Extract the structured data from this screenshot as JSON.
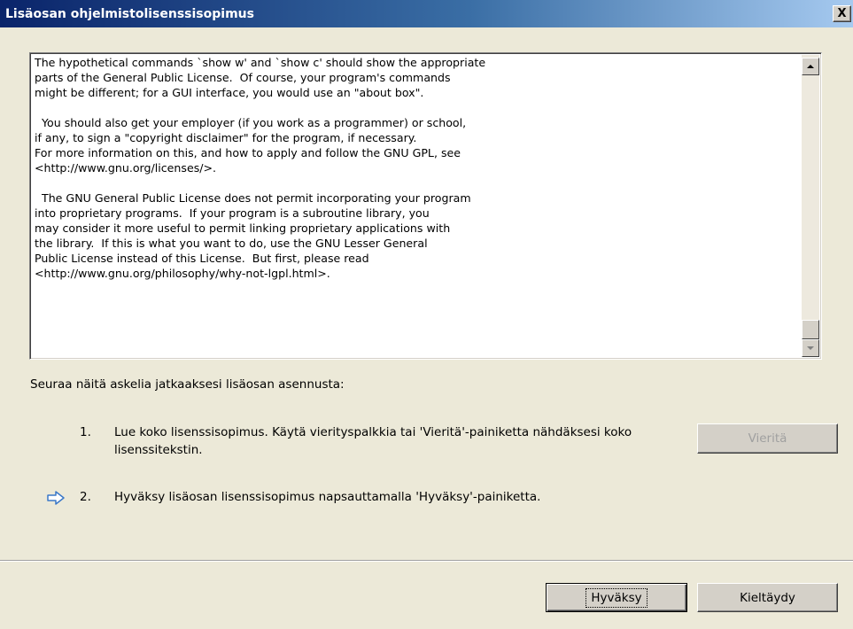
{
  "window": {
    "title": "Lisäosan ohjelmistolisenssisopimus",
    "close_glyph": "X"
  },
  "license": {
    "text": "The hypothetical commands `show w' and `show c' should show the appropriate\nparts of the General Public License.  Of course, your program's commands\nmight be different; for a GUI interface, you would use an \"about box\".\n\n  You should also get your employer (if you work as a programmer) or school,\nif any, to sign a \"copyright disclaimer\" for the program, if necessary.\nFor more information on this, and how to apply and follow the GNU GPL, see\n<http://www.gnu.org/licenses/>.\n\n  The GNU General Public License does not permit incorporating your program\ninto proprietary programs.  If your program is a subroutine library, you\nmay consider it more useful to permit linking proprietary applications with\nthe library.  If this is what you want to do, use the GNU Lesser General\nPublic License instead of this License.  But first, please read\n<http://www.gnu.org/philosophy/why-not-lgpl.html>."
  },
  "instructions": {
    "heading": "Seuraa näitä askelia jatkaaksesi lisäosan asennusta:",
    "steps": [
      {
        "number": "1.",
        "text": "Lue koko lisenssisopimus. Käytä vierityspalkkia tai 'Vieritä'-painiketta nähdäksesi koko lisenssitekstin."
      },
      {
        "number": "2.",
        "text": "Hyväksy lisäosan lisenssisopimus napsauttamalla 'Hyväksy'-painiketta."
      }
    ],
    "current_step_icon": "arrow-right-icon",
    "scroll_button_label": "Vieritä"
  },
  "buttons": {
    "accept": "Hyväksy",
    "decline": "Kieltäydy"
  },
  "colors": {
    "titlebar_start": "#0a246a",
    "titlebar_end": "#a6caf0",
    "dialog_bg": "#ece9d8",
    "arrow": "#3a78c8"
  }
}
